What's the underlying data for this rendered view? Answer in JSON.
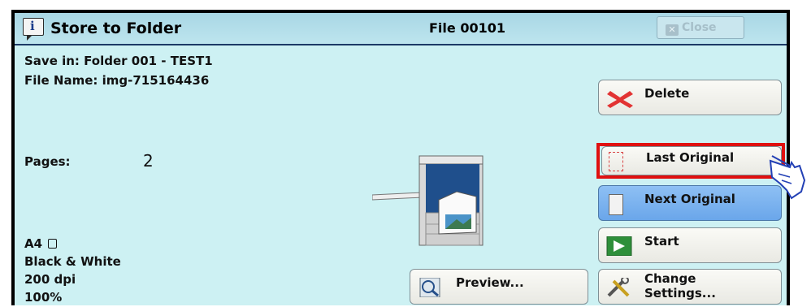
{
  "window": {
    "title": "Store to Folder",
    "file_label": "File 00101",
    "close_label": "Close"
  },
  "info": {
    "save_in": "Save in: Folder 001 - TEST1",
    "file_name": "File Name: img-715164436",
    "pages_label": "Pages:",
    "pages_value": "2",
    "paper": "A4",
    "color_mode": "Black & White",
    "resolution": "200 dpi",
    "scale": "100%"
  },
  "buttons": {
    "delete": "Delete",
    "last_original": "Last Original",
    "next_original": "Next Original",
    "start": "Start",
    "preview": "Preview...",
    "change_settings_line1": "Change",
    "change_settings_line2": "Settings..."
  },
  "colors": {
    "accent_highlight": "#e01010",
    "panel_background": "#cdf1f3",
    "next_original_bg": "#7fb4ef"
  }
}
